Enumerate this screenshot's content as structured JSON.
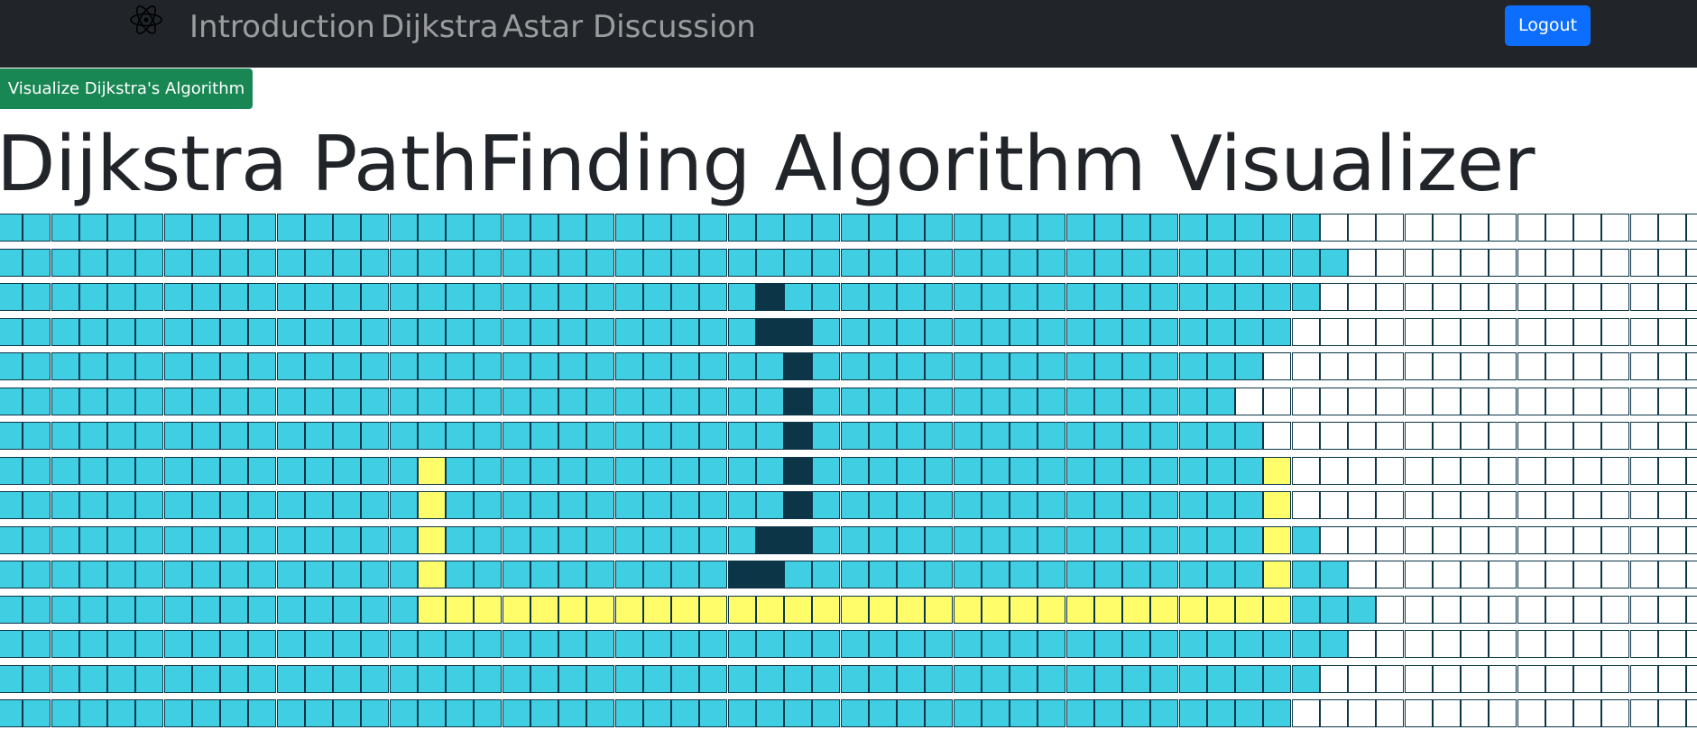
{
  "navbar": {
    "logo_icon": "atom-icon",
    "links": [
      "Introduction",
      "Dijkstra",
      "Astar",
      "Discussion"
    ],
    "logout_label": "Logout"
  },
  "controls": {
    "visualize_label": "Visualize Dijkstra's Algorithm"
  },
  "page_title": "Dijkstra PathFinding Algorithm Visualizer",
  "colors": {
    "navbar_bg": "#212529",
    "nav_link": "rgba(255,255,255,0.55)",
    "logout_bg": "#0d6efd",
    "visualize_bg": "#198754",
    "visited": "#40cee3",
    "wall": "#0c3547",
    "path": "#fffe6a",
    "unvisited": "#ffffff"
  },
  "grid": {
    "legend": {
      "W": "unvisited",
      "V": "visited",
      "X": "wall",
      "P": "path"
    },
    "rows": [
      "VVVVVVVVVVVVVVVVVVVVVVVVVVVVVVVVVVVVVVVVVVVVVVVWWWWWWWWWWWWWW",
      "VVVVVVVVVVVVVVVVVVVVVVVVVVVVVVVVVVVVVVVVVVVVVVVVWWWWWWWWWWWWW",
      "VVVVVVVVVVVVVVVVVVVVVVVVVVVXVVVVVVVVVVVVVVVVVVVWWWWWWWWWWWWWW",
      "VVVVVVVVVVVVVVVVVVVVVVVVVVVXXVVVVVVVVVVVVVVVVVWWWWWWWWWWWWWWW",
      "VVVVVVVVVVVVVVVVVVVVVVVVVVVVXVVVVVVVVVVVVVVVVWWWWWWWWWWWWWWWW",
      "VVVVVVVVVVVVVVVVVVVVVVVVVVVVXVVVVVVVVVVVVVVVWWWWWWWWWWWWWWWWW",
      "VVVVVVVVVVVVVVVVVVVVVVVVVVVVXVVVVVVVVVVVVVVVVWWWWWWWWWWWWWWWW",
      "VVVVVVVVVVVVVVVPVVVVVVVVVVVVXVVVVVVVVVVVVVVVVPWWWWWWWWWWWWWWW",
      "VVVVVVVVVVVVVVVPVVVVVVVVVVVVXVVVVVVVVVVVVVVVVPWWWWWWWWWWWWWWW",
      "VVVVVVVVVVVVVVVPVVVVVVVVVVVXXVVVVVVVVVVVVVVVVPVWWWWWWWWWWWWWW",
      "VVVVVVVVVVVVVVVPVVVVVVVVVVXXVVVVVVVVVVVVVVVVVPVVWWWWWWWWWWWWW",
      "VVVVVVVVVVVVVVVPPPPPPPPPPPPPPPPPPPPPPPPPPPPPPPVVVWWWWWWWWWWWW",
      "VVVVVVVVVVVVVVVVVVVVVVVVVVVVVVVVVVVVVVVVVVVVVVVVWWWWWWWWWWWWW",
      "VVVVVVVVVVVVVVVVVVVVVVVVVVVVVVVVVVVVVVVVVVVVVVVWWWWWWWWWWWWWW",
      "VVVVVVVVVVVVVVVVVVVVVVVVVVVVVVVVVVVVVVVVVVVVVVWWWWWWWWWWWWWWW"
    ]
  }
}
